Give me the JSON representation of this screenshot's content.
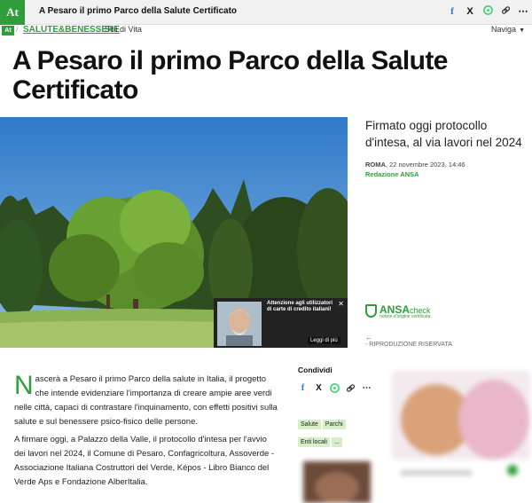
{
  "topbar": {
    "logo_text": "At",
    "title": "A Pesaro il primo Parco della Salute Certificato",
    "share_icons": [
      "facebook-icon",
      "x-icon",
      "whatsapp-icon",
      "link-icon",
      "more-icon"
    ]
  },
  "breadcrumb": {
    "logo_text": "At",
    "section": "SALUTE&BENESSERE",
    "subsection": "Stili di Vita",
    "navigate_label": "Naviga"
  },
  "article": {
    "headline": "A Pesaro il primo Parco della Salute Certificato",
    "subtitle": "Firmato oggi protocollo d'intesa, al via lavori nel 2024",
    "location": "ROMA",
    "date": ", 22 novembre 2023, 14:46",
    "author": "Redazione ANSA",
    "dropcap": "N",
    "paragraph1": "ascerà a Pesaro il primo Parco della salute in Italia, il progetto che intende evidenziare l'importanza di creare ampie aree verdi nelle città, capaci di contrastare l'inquinamento, con effetti positivi sulla salute e sul benessere psico-fisico delle persone.",
    "paragraph2": "A firmare oggi, a Palazzo della Valle, il protocollo d'intesa per l'avvio dei lavori nel 2024, il Comune di Pesaro, Confagricoltura, Assoverde - Associazione Italiana Costruttori del Verde, Képos - Libro Bianco del Verde Aps e Fondazione AlberItalia."
  },
  "overlay_ad": {
    "text": "Attenzione agli utilizzatori di carte di credito italiani!",
    "button": "Leggi di più",
    "close_icon": "close-icon"
  },
  "ansa_check": {
    "brand": "ANSA",
    "brand_suffix": "check",
    "tagline": "notizie d'origine certificata"
  },
  "rights": "- RIPRODUZIONE RISERVATA",
  "share": {
    "heading": "Condividi",
    "icons": [
      "facebook-icon",
      "x-icon",
      "whatsapp-icon",
      "link-icon",
      "more-icon"
    ]
  },
  "tags": [
    "Salute",
    "Parchi",
    "Enti locali",
    "..."
  ],
  "colors": {
    "brand_green": "#2e9d3a",
    "tag_bg": "#d7efc9"
  }
}
